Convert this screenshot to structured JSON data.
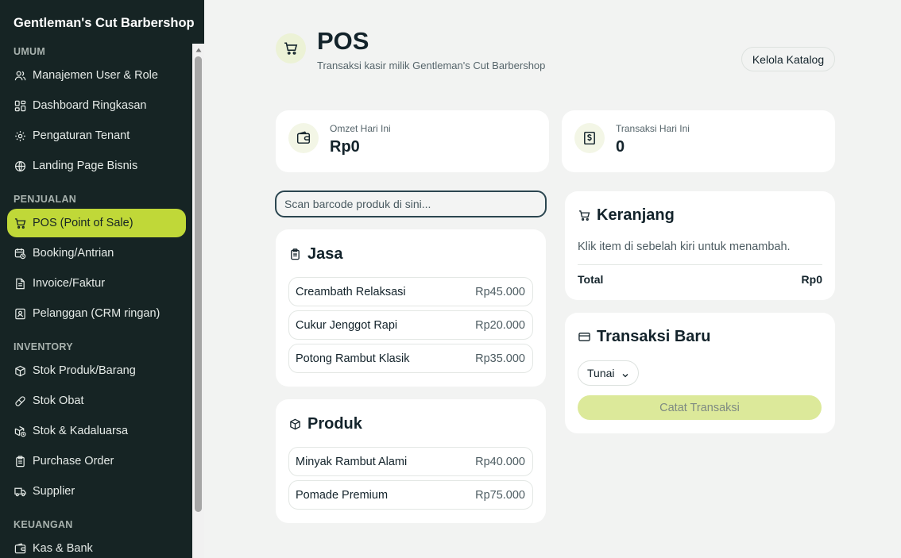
{
  "sidebar": {
    "brand": "Gentleman's Cut Barbershop",
    "sections": {
      "umum": "UMUM",
      "penjualan": "PENJUALAN",
      "inventory": "INVENTORY",
      "keuangan": "KEUANGAN"
    },
    "items": {
      "manajemen_user": "Manajemen User & Role",
      "dashboard": "Dashboard Ringkasan",
      "pengaturan": "Pengaturan Tenant",
      "landing": "Landing Page Bisnis",
      "pos": "POS (Point of Sale)",
      "booking": "Booking/Antrian",
      "invoice": "Invoice/Faktur",
      "pelanggan": "Pelanggan (CRM ringan)",
      "stok_produk": "Stok Produk/Barang",
      "stok_obat": "Stok Obat",
      "stok_kadaluarsa": "Stok & Kadaluarsa",
      "purchase_order": "Purchase Order",
      "supplier": "Supplier",
      "kas_bank": "Kas & Bank"
    },
    "active_item": "pos"
  },
  "header": {
    "title": "POS",
    "subtitle": "Transaksi kasir milik Gentleman's Cut Barbershop",
    "catalog_button": "Kelola Katalog"
  },
  "stats": {
    "omzet": {
      "label": "Omzet Hari Ini",
      "value": "Rp0"
    },
    "transaksi": {
      "label": "Transaksi Hari Ini",
      "value": "0"
    }
  },
  "scan": {
    "placeholder": "Scan barcode produk di sini..."
  },
  "jasa": {
    "title": "Jasa",
    "items": [
      {
        "name": "Creambath Relaksasi",
        "price": "Rp45.000"
      },
      {
        "name": "Cukur Jenggot Rapi",
        "price": "Rp20.000"
      },
      {
        "name": "Potong Rambut Klasik",
        "price": "Rp35.000"
      }
    ]
  },
  "produk": {
    "title": "Produk",
    "items": [
      {
        "name": "Minyak Rambut Alami",
        "price": "Rp40.000"
      },
      {
        "name": "Pomade Premium",
        "price": "Rp75.000"
      }
    ]
  },
  "cart": {
    "title": "Keranjang",
    "empty_text": "Klik item di sebelah kiri untuk menambah.",
    "total_label": "Total",
    "total_value": "Rp0"
  },
  "new_transaction": {
    "title": "Transaksi Baru",
    "payment_method": "Tunai",
    "submit_label": "Catat Transaksi"
  },
  "colors": {
    "sidebar_bg": "#162424",
    "accent": "#c0d838",
    "page_bg": "#f2f3f2",
    "submit_disabled": "#dce99a"
  }
}
